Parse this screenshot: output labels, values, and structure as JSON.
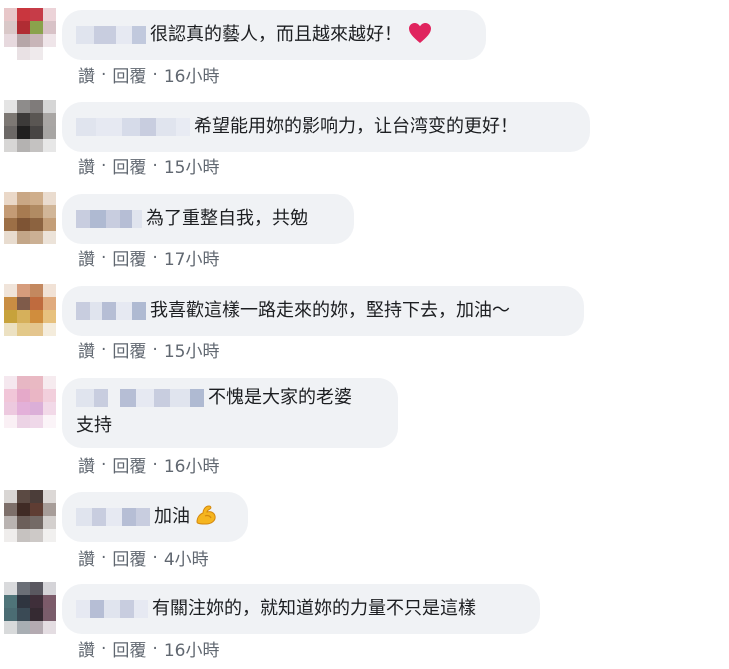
{
  "comments": [
    {
      "text": "很認真的藝人，而且越來越好！",
      "emoji": "heart-icon",
      "actions": {
        "like": "讚",
        "reply": "回覆",
        "time": "16小時"
      },
      "avatar_colors": [
        "#e8c7c9",
        "#c9363e",
        "#c63c48",
        "#ecd3d8",
        "#d9c8c8",
        "#b02c33",
        "#8aa24c",
        "#d8c2c7",
        "#e7d9de",
        "#b6a6a8",
        "#c8b5b8",
        "#efe5e9",
        "#ffffff",
        "#e9e1e4",
        "#efeaec",
        "#ffffff"
      ]
    },
    {
      "text": "希望能用妳的影响力，让台湾变的更好！",
      "actions": {
        "like": "讚",
        "reply": "回覆",
        "time": "15小時"
      },
      "avatar_colors": [
        "#e4e4e4",
        "#8e8c8b",
        "#7f7b7a",
        "#d6d6d6",
        "#7d7874",
        "#3c3a39",
        "#5a5653",
        "#a9a6a4",
        "#6c6866",
        "#201f1f",
        "#484544",
        "#a7a5a3",
        "#d7d6d5",
        "#b4b2b1",
        "#c4c2c1",
        "#e7e7e7"
      ]
    },
    {
      "text": "為了重整自我，共勉",
      "actions": {
        "like": "讚",
        "reply": "回覆",
        "time": "17小時"
      },
      "avatar_colors": [
        "#ead8c8",
        "#c9a785",
        "#cfae8b",
        "#eadccf",
        "#c49b75",
        "#a77b51",
        "#b18b63",
        "#d1b698",
        "#9c6f46",
        "#7e5434",
        "#8c6340",
        "#c39e78",
        "#e8dccf",
        "#c3a688",
        "#cbb094",
        "#ece3d9"
      ]
    },
    {
      "text": "我喜歡這樣一路走來的妳，堅持下去，加油～",
      "actions": {
        "like": "讚",
        "reply": "回覆",
        "time": "15小時"
      },
      "avatar_colors": [
        "#f0e4da",
        "#d69c7c",
        "#c3885f",
        "#f1e2d6",
        "#c98d43",
        "#7f5b4a",
        "#bf6b3e",
        "#e0ab7e",
        "#c7a23b",
        "#d6b05b",
        "#d08d3d",
        "#e7c17e",
        "#ece1c2",
        "#e3c989",
        "#e4c58e",
        "#f4ecdc"
      ]
    },
    {
      "text": "不愧是大家的老婆",
      "text2": "支持",
      "actions": {
        "like": "讚",
        "reply": "回覆",
        "time": "16小時"
      },
      "avatar_colors": [
        "#f5e8ef",
        "#e7b7c4",
        "#e9b9c3",
        "#f6ebef",
        "#f1c6d8",
        "#e5a9c9",
        "#eab6c5",
        "#f2cfdc",
        "#edc9df",
        "#e3b0d9",
        "#dbafd8",
        "#f2d9e8",
        "#faf0f5",
        "#ecd3e5",
        "#efd8e9",
        "#fbf4f8"
      ]
    },
    {
      "text": "加油",
      "emoji": "flexed-biceps-icon",
      "actions": {
        "like": "讚",
        "reply": "回覆",
        "time": "4小時"
      },
      "avatar_colors": [
        "#d9d6d4",
        "#5b4a43",
        "#4b3d39",
        "#dcd8d6",
        "#7d6f6a",
        "#402b25",
        "#5f3d33",
        "#a79d99",
        "#b9b3b1",
        "#6c5f5a",
        "#746a66",
        "#d4d0ce",
        "#efedec",
        "#c6c2c0",
        "#cdc9c7",
        "#f1f0ef"
      ]
    },
    {
      "text": "有關注妳的，就知道妳的力量不只是這樣",
      "actions": {
        "like": "讚",
        "reply": "回覆",
        "time": "16小時"
      },
      "avatar_colors": [
        "#d9dadc",
        "#6b6f77",
        "#5a5860",
        "#d5d4d8",
        "#4f7479",
        "#2f3540",
        "#3f2f3a",
        "#7c5b6a",
        "#4b6c73",
        "#3a4a55",
        "#352a32",
        "#7a5d6b",
        "#d8dadb",
        "#a8aeb3",
        "#b4aab1",
        "#e4dde2"
      ]
    }
  ],
  "name_blur_colors": [
    "#e6e9f2",
    "#c9cfe0",
    "#b0b9d2",
    "#dfe3ee",
    "#a9b4cf",
    "#d7dcea"
  ],
  "colors": {
    "bubble": "#f0f2f5",
    "text": "#1c1e21",
    "meta": "#606770",
    "heart": "#e0245e"
  }
}
